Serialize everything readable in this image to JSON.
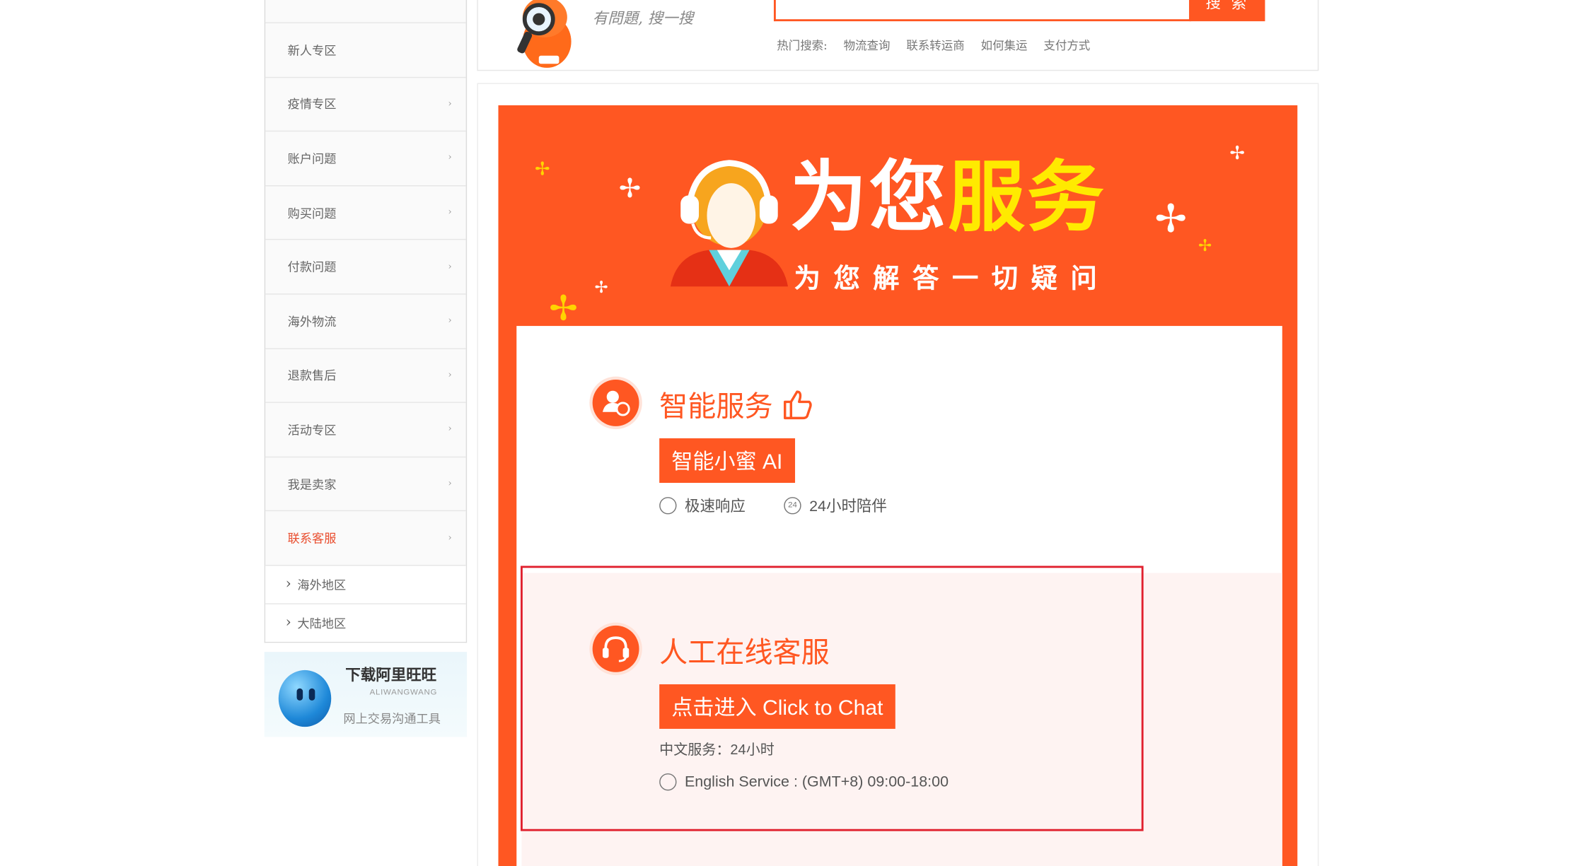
{
  "header": {
    "slogan": "有問題, 搜一搜",
    "search_button": "搜 索",
    "hot_label": "热门搜索:",
    "hot_links": [
      "物流查询",
      "联系转运商",
      "如何集运",
      "支付方式"
    ]
  },
  "sidebar": {
    "items": [
      {
        "label": "新人专区",
        "has_arrow": false
      },
      {
        "label": "疫情专区",
        "has_arrow": true
      },
      {
        "label": "账户问题",
        "has_arrow": true
      },
      {
        "label": "购买问题",
        "has_arrow": true
      },
      {
        "label": "付款问题",
        "has_arrow": true
      },
      {
        "label": "海外物流",
        "has_arrow": true
      },
      {
        "label": "退款售后",
        "has_arrow": true
      },
      {
        "label": "活动专区",
        "has_arrow": true
      },
      {
        "label": "我是卖家",
        "has_arrow": true
      },
      {
        "label": "联系客服",
        "has_arrow": true,
        "active": true
      }
    ],
    "sub_items": [
      "海外地区",
      "大陆地区"
    ],
    "chevron": "›",
    "sub_arrow": "›"
  },
  "wangwang_banner": {
    "title": "下载阿里旺旺",
    "subtitle": "ALIWANGWANG",
    "desc": "网上交易沟通工具"
  },
  "banner": {
    "title_white": "为您",
    "title_yellow": "服务",
    "subtitle": "为您解答一切疑问"
  },
  "smart_service": {
    "title": "智能服务",
    "button": "智能小蜜 AI",
    "features": [
      "极速响应",
      "24小时陪伴"
    ]
  },
  "human_service": {
    "title": "人工在线客服",
    "button": "点击进入 Click to Chat",
    "chinese_hours": "中文服务：24小时",
    "english_hours": "English Service : (GMT+8) 09:00-18:00"
  },
  "colors": {
    "accent": "#ff5722",
    "highlight": "#ffea00",
    "frame": "#e0202e"
  }
}
